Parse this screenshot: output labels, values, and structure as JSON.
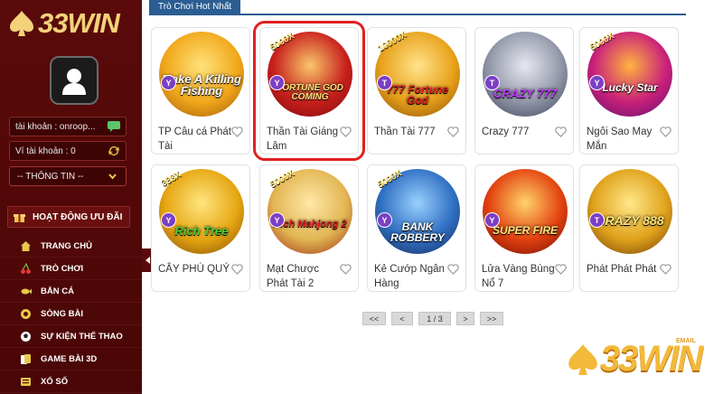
{
  "brand": {
    "logo_text": "33WIN",
    "gold": "#f3d27a",
    "sidebar_bg": "#5a0a0a"
  },
  "account": {
    "username_label": "tài khoản : onroop...",
    "wallet_label": "Ví tài khoản : 0",
    "info_button": "-- THÔNG TIN --"
  },
  "promo": {
    "label": "HOẠT ĐỘNG ƯU ĐÃI"
  },
  "menu": {
    "items": [
      {
        "label": "TRANG CHỦ",
        "icon": "home-icon"
      },
      {
        "label": "TRÒ CHƠI",
        "icon": "cherry-icon"
      },
      {
        "label": "BẮN CÁ",
        "icon": "fish-icon"
      },
      {
        "label": "SÒNG BÀI",
        "icon": "chips-icon"
      },
      {
        "label": "SỰ KIỆN THỂ THAO",
        "icon": "sport-icon"
      },
      {
        "label": "GAME BÀI 3D",
        "icon": "cards-icon"
      },
      {
        "label": "XỔ SỐ",
        "icon": "lottery-icon"
      }
    ]
  },
  "section": {
    "title": "Trò Chơi Hot Nhất",
    "accent": "#2b5d93"
  },
  "games": [
    {
      "name": "TP Câu cá Phát Tài",
      "art": "Make A Killing Fishing",
      "badge": "Y",
      "multiplier": ""
    },
    {
      "name": "Thần Tài Giáng Lâm",
      "art": "FORTUNE GOD COMING",
      "badge": "Y",
      "multiplier": "5000X"
    },
    {
      "name": "Thần Tài 777",
      "art": "777 Fortune God",
      "badge": "T",
      "multiplier": "10000X"
    },
    {
      "name": "Crazy 777",
      "art": "CRAZY 777",
      "badge": "T",
      "multiplier": ""
    },
    {
      "name": "Ngôi Sao May Mắn",
      "art": "Lucky Star",
      "badge": "Y",
      "multiplier": "5000X"
    },
    {
      "name": "CÂY PHÚ QUÝ",
      "art": "Rich Tree",
      "badge": "Y",
      "multiplier": "388X"
    },
    {
      "name": "Mạt Chược Phát Tài 2",
      "art": "Rich Mahjong 2",
      "badge": "Y",
      "multiplier": "5000X"
    },
    {
      "name": "Kẻ Cướp Ngân Hàng",
      "art": "BANK ROBBERY",
      "badge": "Y",
      "multiplier": "5000X"
    },
    {
      "name": "Lửa Vàng Bùng Nổ 7",
      "art": "SUPER FIRE",
      "badge": "Y",
      "multiplier": ""
    },
    {
      "name": "Phát Phát Phát",
      "art": "CRAZY 888",
      "badge": "T",
      "multiplier": ""
    }
  ],
  "pagination": {
    "first": "<<",
    "prev": "<",
    "page": "1 / 3",
    "next": ">",
    "last": ">>"
  },
  "watermark": {
    "text": "33WIN",
    "email": "EMAIL"
  }
}
